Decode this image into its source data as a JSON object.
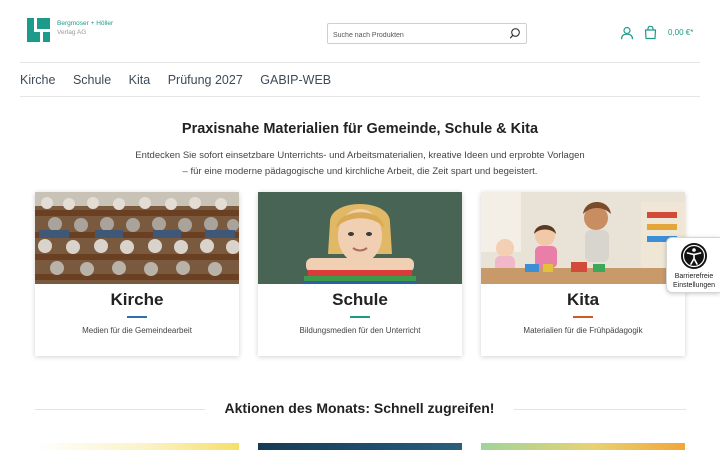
{
  "header": {
    "logo": {
      "name": "Bergmoser + Höller",
      "sub": "Verlag AG",
      "color": "#1c9a8a"
    },
    "search": {
      "placeholder": "Suche nach Produkten",
      "icon": "search-icon"
    },
    "account_icon": "user-icon",
    "cart_icon": "shopping-bag-icon",
    "cart_total": "0,00 €*",
    "accent": "#1c9a8a"
  },
  "nav": {
    "items": [
      {
        "label": "Kirche"
      },
      {
        "label": "Schule"
      },
      {
        "label": "Kita"
      },
      {
        "label": "Prüfung 2027"
      },
      {
        "label": "GABIP-WEB"
      }
    ]
  },
  "hero": {
    "title": "Praxisnahe Materialien für Gemeinde, Schule & Kita",
    "desc_line1": "Entdecken Sie sofort einsetzbare Unterrichts- und Arbeitsmaterialien, kreative Ideen und erprobte Vorlagen",
    "desc_line2": "– für eine moderne pädagogische und kirchliche Arbeit, die Zeit spart und begeistert."
  },
  "cards": [
    {
      "title": "Kirche",
      "subtitle": "Medien für die Gemeindearbeit",
      "accent": "#2f6fae"
    },
    {
      "title": "Schule",
      "subtitle": "Bildungsmedien für den Unterricht",
      "accent": "#1c9a8a"
    },
    {
      "title": "Kita",
      "subtitle": "Materialien für die Frühpädagogik",
      "accent": "#d4581f"
    }
  ],
  "accessibility": {
    "line1": "Barrierefreie",
    "line2": "Einstellungen",
    "icon": "accessibility-icon"
  },
  "section": {
    "title": "Aktionen des Monats: Schnell zugreifen!"
  }
}
